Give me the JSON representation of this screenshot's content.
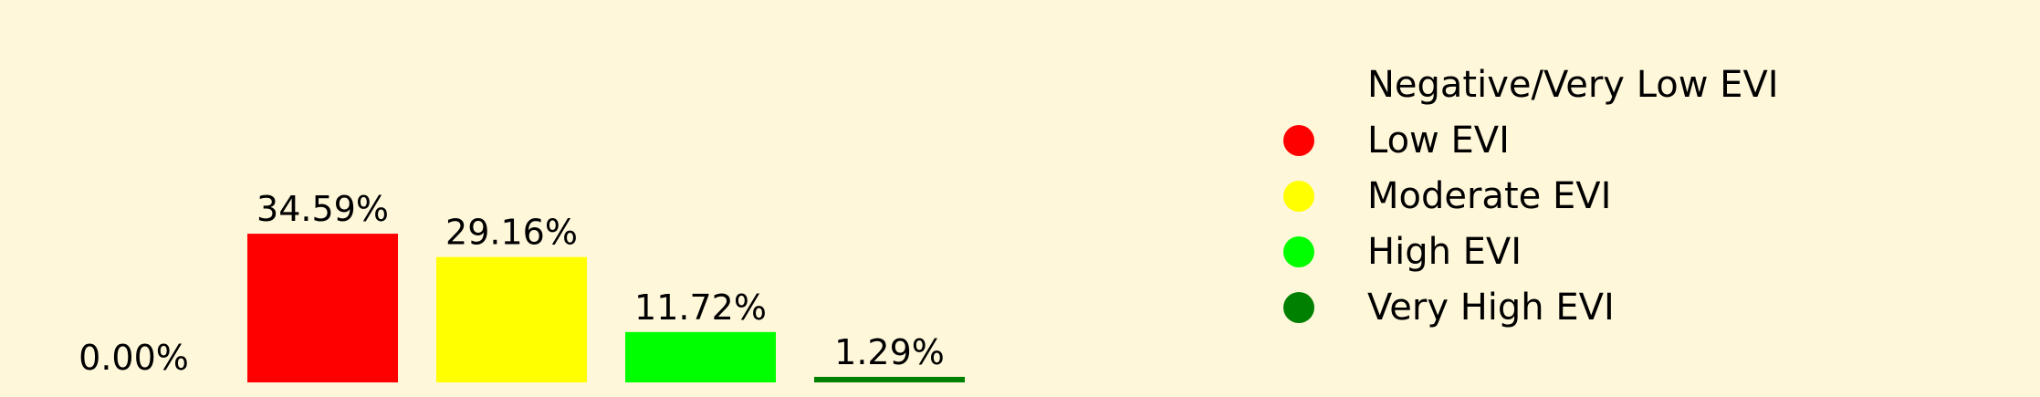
{
  "chart_data": {
    "type": "bar",
    "categories": [
      "Negative/Very Low EVI",
      "Low EVI",
      "Moderate EVI",
      "High EVI",
      "Very High EVI"
    ],
    "values": [
      0.0,
      34.59,
      29.16,
      11.72,
      1.29
    ],
    "value_labels": [
      "0.00%",
      "34.59%",
      "29.16%",
      "11.72%",
      "1.29%"
    ],
    "colors": [
      "#fff7da",
      "#ff0000",
      "#ffff00",
      "#00ff00",
      "#008000"
    ],
    "ylim": [
      0,
      40
    ],
    "grid": false,
    "legend_placement": "right"
  },
  "legend": {
    "items": [
      {
        "label": "Negative/Very Low EVI",
        "color": "#fff7da"
      },
      {
        "label": "Low EVI",
        "color": "#ff0000"
      },
      {
        "label": "Moderate EVI",
        "color": "#ffff00"
      },
      {
        "label": "High EVI",
        "color": "#00ff00"
      },
      {
        "label": "Very High EVI",
        "color": "#008000"
      }
    ]
  }
}
